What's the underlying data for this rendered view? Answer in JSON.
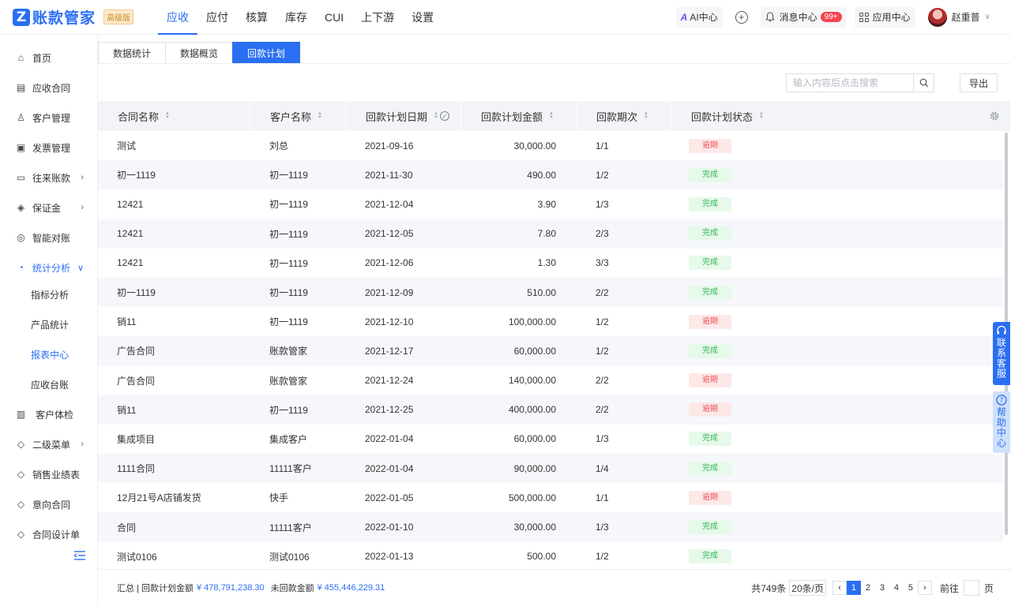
{
  "app": {
    "logo_letter": "Z",
    "name": "账款管家",
    "badge": "高级版"
  },
  "topnav": [
    "应收",
    "应付",
    "核算",
    "库存",
    "CUI",
    "上下游",
    "设置"
  ],
  "header": {
    "ai_label": "AI中心",
    "notice_label": "消息中心",
    "notice_count": "99+",
    "apps_label": "应用中心",
    "user_name": "赵重普"
  },
  "sidebar": {
    "items": [
      {
        "label": "首页",
        "icon": "home-icon"
      },
      {
        "label": "应收合同",
        "icon": "contract-icon"
      },
      {
        "label": "客户管理",
        "icon": "user-icon"
      },
      {
        "label": "发票管理",
        "icon": "invoice-icon"
      },
      {
        "label": "往来账款",
        "icon": "wallet-icon"
      },
      {
        "label": "保证金",
        "icon": "diamond-icon"
      },
      {
        "label": "智能对账",
        "icon": "target-icon"
      },
      {
        "label": "统计分析",
        "icon": "pie-chart-icon"
      }
    ],
    "sub_items": [
      "指标分析",
      "产品统计",
      "报表中心",
      "应收台账"
    ],
    "items_after": [
      {
        "label": "客户体检",
        "icon": "monitor-icon"
      },
      {
        "label": "二级菜单",
        "icon": "tag-icon"
      },
      {
        "label": "销售业绩表",
        "icon": "tag-icon"
      },
      {
        "label": "意向合同",
        "icon": "tag-icon"
      },
      {
        "label": "合同设计单",
        "icon": "tag-icon"
      }
    ]
  },
  "tabs": [
    "数据统计",
    "数据概览",
    "回款计划"
  ],
  "search": {
    "placeholder": "输入内容后点击搜索",
    "export_label": "导出"
  },
  "table": {
    "columns": [
      "合同名称",
      "客户名称",
      "回款计划日期",
      "回款计划金额",
      "回款期次",
      "回款计划状态"
    ],
    "rows": [
      [
        "测试",
        "刘总",
        "2021-09-16",
        "30,000.00",
        "1/1",
        "逾期"
      ],
      [
        "初一1119",
        "初一1119",
        "2021-11-30",
        "490.00",
        "1/2",
        "完成"
      ],
      [
        "12421",
        "初一1119",
        "2021-12-04",
        "3.90",
        "1/3",
        "完成"
      ],
      [
        "12421",
        "初一1119",
        "2021-12-05",
        "7.80",
        "2/3",
        "完成"
      ],
      [
        "12421",
        "初一1119",
        "2021-12-06",
        "1.30",
        "3/3",
        "完成"
      ],
      [
        "初一1119",
        "初一1119",
        "2021-12-09",
        "510.00",
        "2/2",
        "完成"
      ],
      [
        "销11",
        "初一1119",
        "2021-12-10",
        "100,000.00",
        "1/2",
        "逾期"
      ],
      [
        "广告合同",
        "账款管家",
        "2021-12-17",
        "60,000.00",
        "1/2",
        "完成"
      ],
      [
        "广告合同",
        "账款管家",
        "2021-12-24",
        "140,000.00",
        "2/2",
        "逾期"
      ],
      [
        "销11",
        "初一1119",
        "2021-12-25",
        "400,000.00",
        "2/2",
        "逾期"
      ],
      [
        "集成项目",
        "集成客户",
        "2022-01-04",
        "60,000.00",
        "1/3",
        "完成"
      ],
      [
        "1111合同",
        "11111客户",
        "2022-01-04",
        "90,000.00",
        "1/4",
        "完成"
      ],
      [
        "12月21号A店铺发货",
        "快手",
        "2022-01-05",
        "500,000.00",
        "1/1",
        "逾期"
      ],
      [
        "合同",
        "11111客户",
        "2022-01-10",
        "30,000.00",
        "1/3",
        "完成"
      ],
      [
        "测试0106",
        "测试0106",
        "2022-01-13",
        "500.00",
        "1/2",
        "完成"
      ]
    ]
  },
  "footer": {
    "summary_label": "汇总 | 回款计划金额",
    "plan_total": "¥ 478,791,238.30",
    "unpaid_label": "未回款金额",
    "unpaid_total": "¥ 455,446,229.31",
    "total_text": "共749条",
    "page_size": "20条/页",
    "pages": [
      "1",
      "2",
      "3",
      "4",
      "5"
    ],
    "goto_label": "前往",
    "page_unit": "页"
  },
  "float": {
    "service": "联系客服",
    "help": "帮助中心"
  },
  "colors": {
    "accent": "#2a6ff2",
    "ok": "#36b45a",
    "overdue": "#f05050"
  }
}
